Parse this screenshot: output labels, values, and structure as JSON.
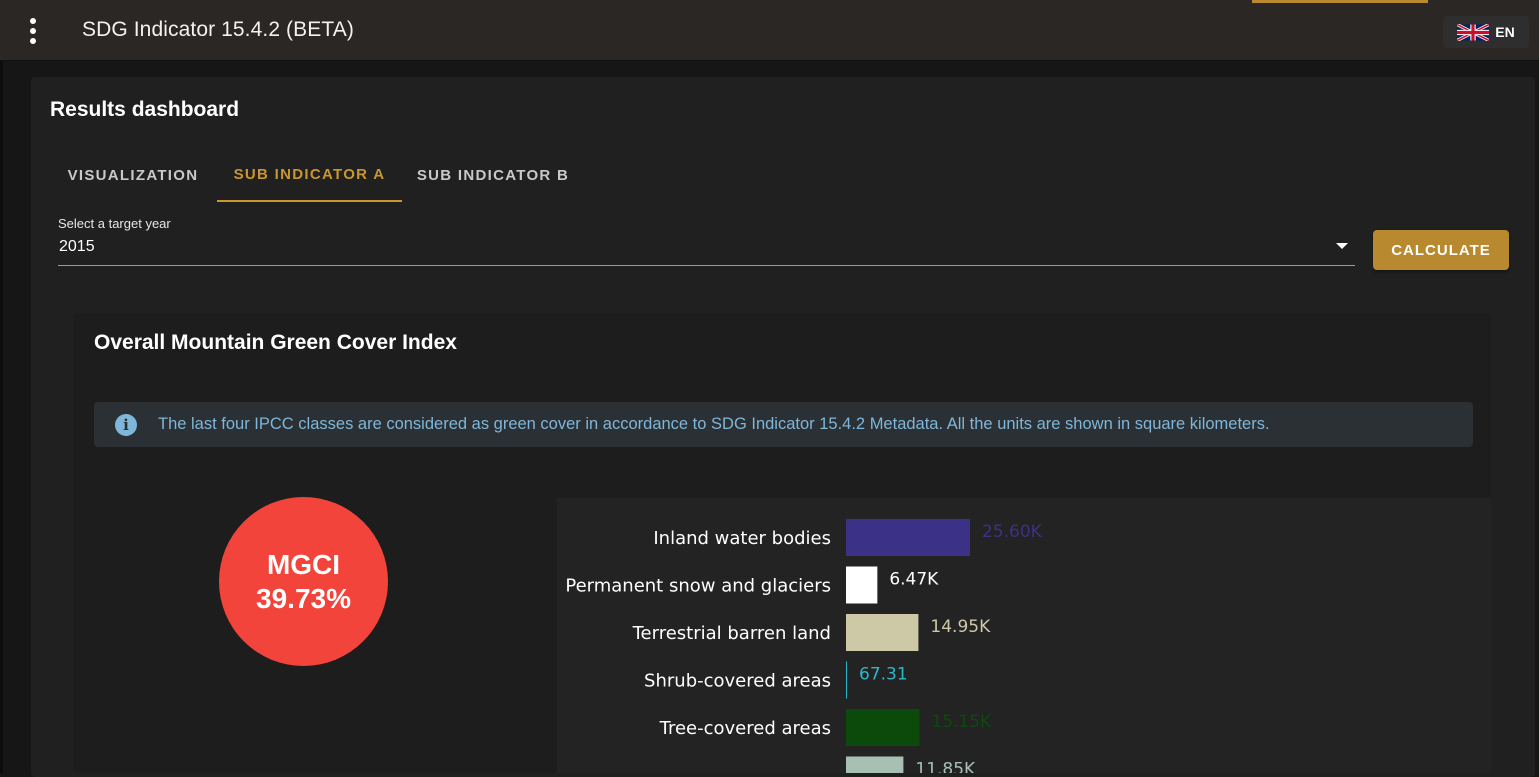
{
  "app": {
    "title": "SDG Indicator 15.4.2 (BETA)",
    "language": "EN"
  },
  "dashboard": {
    "title": "Results dashboard",
    "tabs": [
      {
        "label": "VISUALIZATION",
        "active": false
      },
      {
        "label": "SUB INDICATOR A",
        "active": true
      },
      {
        "label": "SUB INDICATOR B",
        "active": false
      }
    ],
    "year_select": {
      "label": "Select a target year",
      "value": "2015"
    },
    "calculate_label": "CALCULATE"
  },
  "mgci_panel": {
    "title": "Overall Mountain Green Cover Index",
    "info_text": "The last four IPCC classes are considered as green cover in accordance to SDG Indicator 15.4.2 Metadata. All the units are shown in square kilometers.",
    "mgci_label": "MGCI",
    "mgci_value": "39.73%"
  },
  "colors": {
    "accent": "#b8892e",
    "mgci_circle": "#f2443a",
    "info_text": "#7fb6d9"
  },
  "chart_data": {
    "type": "bar",
    "orientation": "horizontal",
    "categories": [
      "Inland water bodies",
      "Permanent snow and glaciers",
      "Terrestrial barren land",
      "Shrub-covered areas",
      "Tree-covered areas",
      ""
    ],
    "values": [
      25600,
      6470,
      14950,
      67.31,
      15150,
      11850
    ],
    "value_labels": [
      "25.60K",
      "6.47K",
      "14.95K",
      "67.31",
      "15.15K",
      "11.85K"
    ],
    "colors": [
      "#3b3186",
      "#ffffff",
      "#cdc9a7",
      "#2bb8c9",
      "#0c4a0c",
      "#a8c0b4"
    ],
    "label_colors": [
      "#3b3186",
      "#ffffff",
      "#cdc9a7",
      "#2bb8c9",
      "#0c4a0c",
      "#a8c0b4"
    ]
  }
}
